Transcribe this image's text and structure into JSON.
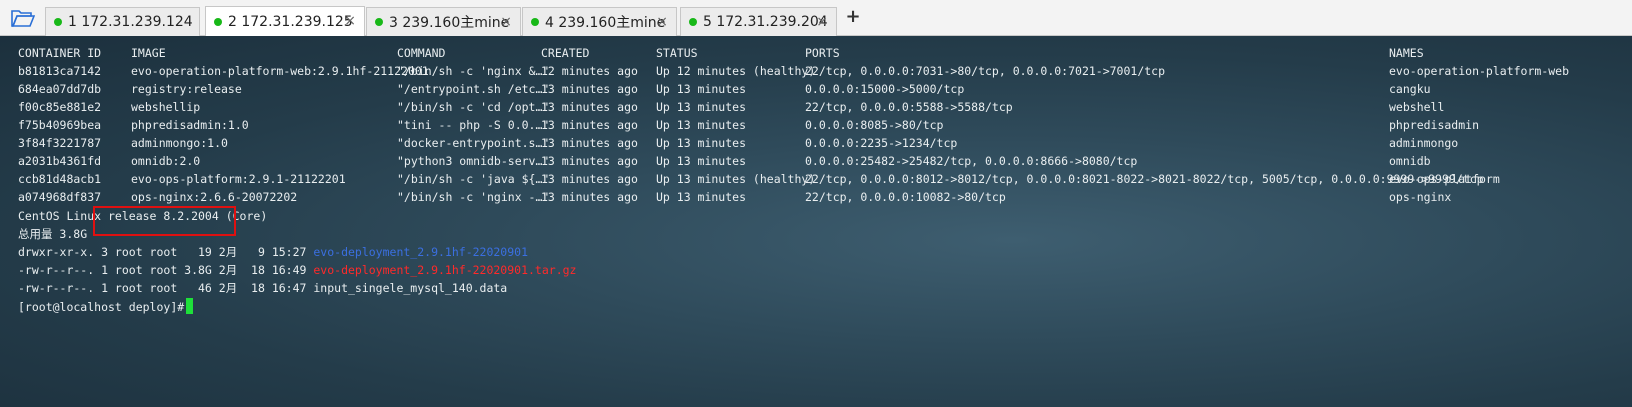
{
  "tabs": [
    {
      "label": "1 172.31.239.124"
    },
    {
      "label": "2 172.31.239.125"
    },
    {
      "label": "3 239.160主mine"
    },
    {
      "label": "4 239.160主mine"
    },
    {
      "label": "5 172.31.239.204"
    }
  ],
  "close_glyph": "×",
  "add_glyph": "+",
  "header": {
    "container_id": "CONTAINER ID",
    "image": "IMAGE",
    "command": "COMMAND",
    "created": "CREATED",
    "status": "STATUS",
    "ports": "PORTS",
    "names": "NAMES"
  },
  "rows": [
    {
      "id": "b81813ca7142",
      "image": "evo-operation-platform-web:2.9.1hf-21122001",
      "command": "\"/bin/sh -c 'nginx &…\"",
      "created": "12 minutes ago",
      "status": "Up 12 minutes (healthy)",
      "ports": "22/tcp, 0.0.0.0:7031->80/tcp, 0.0.0.0:7021->7001/tcp",
      "names": "evo-operation-platform-web"
    },
    {
      "id": "684ea07dd7db",
      "image": "registry:release",
      "command": "\"/entrypoint.sh /etc…\"",
      "created": "13 minutes ago",
      "status": "Up 13 minutes",
      "ports": "0.0.0.0:15000->5000/tcp",
      "names": "cangku"
    },
    {
      "id": "f00c85e881e2",
      "image": "webshellip",
      "command": "\"/bin/sh -c 'cd /opt…\"",
      "created": "13 minutes ago",
      "status": "Up 13 minutes",
      "ports": "22/tcp, 0.0.0.0:5588->5588/tcp",
      "names": "webshell"
    },
    {
      "id": "f75b40969bea",
      "image": "phpredisadmin:1.0",
      "command": "\"tini -- php -S 0.0.…\"",
      "created": "13 minutes ago",
      "status": "Up 13 minutes",
      "ports": "0.0.0.0:8085->80/tcp",
      "names": "phpredisadmin"
    },
    {
      "id": "3f84f3221787",
      "image": "adminmongo:1.0",
      "command": "\"docker-entrypoint.s…\"",
      "created": "13 minutes ago",
      "status": "Up 13 minutes",
      "ports": "0.0.0.0:2235->1234/tcp",
      "names": "adminmongo"
    },
    {
      "id": "a2031b4361fd",
      "image": "omnidb:2.0",
      "command": "\"python3 omnidb-serv…\"",
      "created": "13 minutes ago",
      "status": "Up 13 minutes",
      "ports": "0.0.0.0:25482->25482/tcp, 0.0.0.0:8666->8080/tcp",
      "names": "omnidb"
    },
    {
      "id": "ccb81d48acb1",
      "image": "evo-ops-platform:2.9.1-21122201",
      "command": "\"/bin/sh -c 'java ${…\"",
      "created": "13 minutes ago",
      "status": "Up 13 minutes (healthy)",
      "ports": "22/tcp, 0.0.0.0:8012->8012/tcp, 0.0.0.0:8021-8022->8021-8022/tcp, 5005/tcp, 0.0.0.0:9999->9999/tcp",
      "names": "evo-ops-platform"
    },
    {
      "id": "a074968df837",
      "image": "ops-nginx:2.6.6-20072202",
      "command": "\"/bin/sh -c 'nginx -…\"",
      "created": "13 minutes ago",
      "status": "Up 13 minutes",
      "ports": "22/tcp, 0.0.0.0:10082->80/tcp",
      "names": "ops-nginx"
    }
  ],
  "os_line": "CentOS Linux release 8.2.2004 (Core)",
  "total_line": "总用量 3.8G",
  "files": [
    {
      "prefix": "drwxr-xr-x. 3 root root   19 2月   9 15:27 ",
      "name": "evo-deployment_2.9.1hf-22020901",
      "color": "#3b6fe0"
    },
    {
      "prefix": "-rw-r--r--. 1 root root 3.8G 2月  18 16:49 ",
      "name": "evo-deployment_2.9.1hf-22020901.tar.gz",
      "color": "#ff2a2a"
    },
    {
      "prefix": "-rw-r--r--. 1 root root   46 2月  18 16:47 ",
      "name": "input_singele_mysql_140.data",
      "color": "#e9eef0"
    }
  ],
  "prompt": "[root@localhost deploy]#",
  "colors": {
    "tab_dot": "#18b818",
    "cursor": "#1ee03a",
    "highlight_box": "#e01010"
  }
}
